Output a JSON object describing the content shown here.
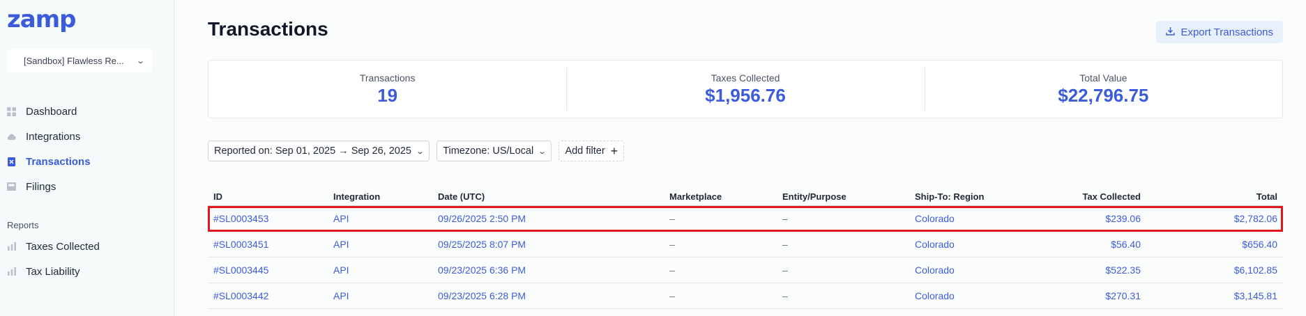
{
  "app": {
    "logo": "zamp",
    "org_name": "[Sandbox] Flawless Re..."
  },
  "sidebar": {
    "items": [
      {
        "label": "Dashboard",
        "icon": "grid-icon",
        "active": false
      },
      {
        "label": "Integrations",
        "icon": "cloud-icon",
        "active": false
      },
      {
        "label": "Transactions",
        "icon": "receipt-icon",
        "active": true
      },
      {
        "label": "Filings",
        "icon": "inbox-icon",
        "active": false
      }
    ],
    "reports_label": "Reports",
    "reports": [
      {
        "label": "Taxes Collected",
        "icon": "bar-chart-icon"
      },
      {
        "label": "Tax Liability",
        "icon": "bar-chart-icon"
      }
    ]
  },
  "header": {
    "title": "Transactions",
    "export_label": "Export Transactions"
  },
  "stats": [
    {
      "label": "Transactions",
      "value": "19"
    },
    {
      "label": "Taxes Collected",
      "value": "$1,956.76"
    },
    {
      "label": "Total Value",
      "value": "$22,796.75"
    }
  ],
  "filters": {
    "reported_on": "Reported on: Sep 01, 2025 → Sep 26, 2025",
    "timezone": "Timezone: US/Local",
    "add_filter": "Add filter"
  },
  "table": {
    "columns": [
      "ID",
      "Integration",
      "Date (UTC)",
      "Marketplace",
      "Entity/Purpose",
      "Ship-To: Region",
      "Tax Collected",
      "Total"
    ],
    "rows": [
      {
        "id": "#SL0003453",
        "integration": "API",
        "date": "09/26/2025 2:50 PM",
        "marketplace": "–",
        "entity": "–",
        "region": "Colorado",
        "tax": "$239.06",
        "total": "$2,782.06",
        "highlighted": true
      },
      {
        "id": "#SL0003451",
        "integration": "API",
        "date": "09/25/2025 8:07 PM",
        "marketplace": "–",
        "entity": "–",
        "region": "Colorado",
        "tax": "$56.40",
        "total": "$656.40"
      },
      {
        "id": "#SL0003445",
        "integration": "API",
        "date": "09/23/2025 6:36 PM",
        "marketplace": "–",
        "entity": "–",
        "region": "Colorado",
        "tax": "$522.35",
        "total": "$6,102.85"
      },
      {
        "id": "#SL0003442",
        "integration": "API",
        "date": "09/23/2025 6:28 PM",
        "marketplace": "–",
        "entity": "–",
        "region": "Colorado",
        "tax": "$270.31",
        "total": "$3,145.81"
      }
    ]
  },
  "colors": {
    "accent": "#3b5bdb",
    "highlight": "#e0161e",
    "sidebar_bg": "#f5fafb"
  }
}
